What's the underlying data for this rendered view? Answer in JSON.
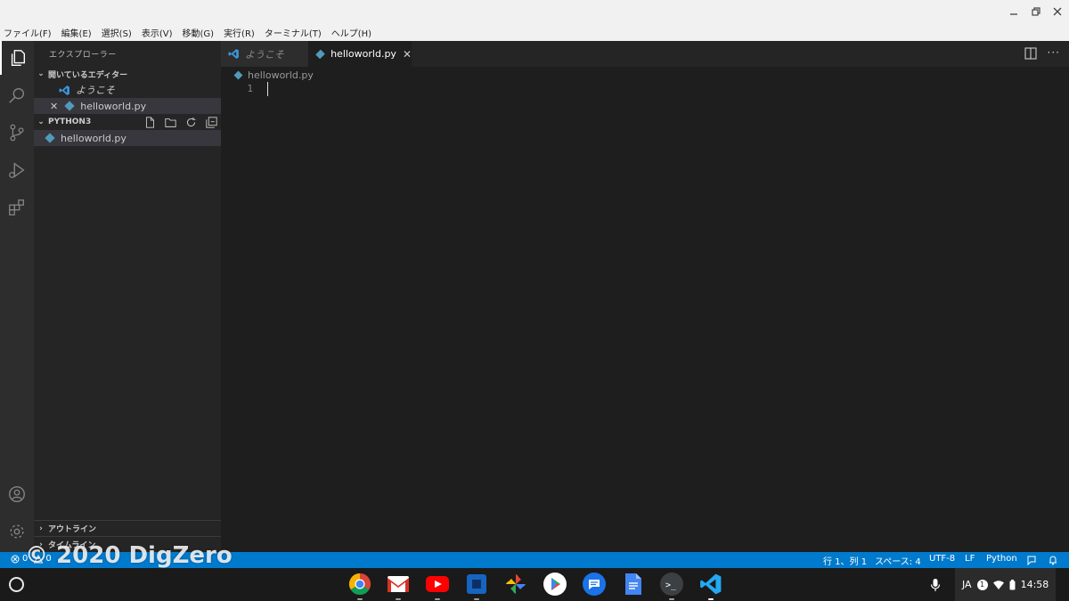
{
  "menubar": {
    "items": [
      "ファイル(F)",
      "編集(E)",
      "選択(S)",
      "表示(V)",
      "移動(G)",
      "実行(R)",
      "ターミナル(T)",
      "ヘルプ(H)"
    ]
  },
  "sidebar": {
    "title": "エクスプローラー",
    "open_editors_label": "開いているエディター",
    "open_editors": [
      "ようこそ",
      "helloworld.py"
    ],
    "folder_label": "PYTHON3",
    "files": [
      "helloworld.py"
    ],
    "outline_label": "アウトライン",
    "timeline_label": "タイムライン"
  },
  "tabs": [
    {
      "label": "ようこそ",
      "active": false
    },
    {
      "label": "helloworld.py",
      "active": true
    }
  ],
  "editor": {
    "breadcrumb": "helloworld.py",
    "line_numbers": [
      "1"
    ]
  },
  "statusbar": {
    "problems": "0",
    "warnings": "0",
    "position": "行 1、列 1",
    "spaces": "スペース: 4",
    "encoding": "UTF-8",
    "eol": "LF",
    "language": "Python"
  },
  "watermark": "© 2020 DigZero",
  "shelf": {
    "ime": "JA",
    "notification_count": "1",
    "time": "14:58"
  },
  "colors": {
    "accent": "#007acc",
    "editor_bg": "#1e1e1e",
    "sidebar_bg": "#252526",
    "activity_bg": "#2d2d2d",
    "python_icon": "#519aba"
  }
}
